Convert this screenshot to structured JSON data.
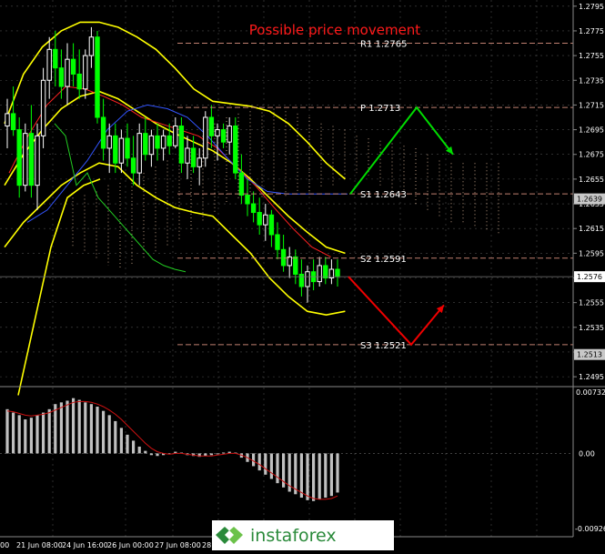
{
  "title": "Possible price movement",
  "colors": {
    "background": "#000000",
    "grid": "#4a4a4a",
    "bollinger": "#ffff00",
    "candle_up": "#ffffff",
    "candle_down": "#00ff00",
    "ma_red": "#ff2222",
    "ma_blue": "#3355ff",
    "chikou": "#22cc22",
    "cloud": "#e8c0a0",
    "level_line": "#c08070",
    "arrow_up": "#00dd00",
    "arrow_down": "#ee0000",
    "histogram": "#c0c0c0",
    "signal": "#cc1111",
    "title": "#ff1a1a",
    "level_text": "#ffffff",
    "axis_text": "#ffffff"
  },
  "levels": [
    {
      "name": "R1",
      "label": "R1 1.2765",
      "value": 1.2765
    },
    {
      "name": "P",
      "label": "P 1.2713",
      "value": 1.2713
    },
    {
      "name": "S1",
      "label": "S1 1.2643",
      "value": 1.2643
    },
    {
      "name": "S2",
      "label": "S2 1.2591",
      "value": 1.2591
    },
    {
      "name": "S3",
      "label": "S3 1.2521",
      "value": 1.2521
    }
  ],
  "price_axis": {
    "ticks": [
      "1.2795",
      "1.2775",
      "1.2755",
      "1.2735",
      "1.2715",
      "1.2695",
      "1.2675",
      "1.2655",
      "1.2635",
      "1.2615",
      "1.2595",
      "1.2575",
      "1.2555",
      "1.2535",
      "1.2515",
      "1.2495"
    ],
    "current_price": "1.2576",
    "marker_upper": "1.2639",
    "marker_lower": "1.2513"
  },
  "macd_axis": {
    "top": "0.00732",
    "zero": "0.00",
    "bottom": "-0.00926"
  },
  "time_labels": [
    "00",
    "21 Jun 08:00",
    "24 Jun 16:00",
    "26 Jun 00:00",
    "27 Jun 08:00",
    "28 Jun"
  ],
  "logo": {
    "brand": "instaforex"
  },
  "chart_data": {
    "type": "candlestick",
    "title": "Possible price movement",
    "ylim": [
      1.2487,
      1.28
    ],
    "candles": [
      {
        "o": 1.2698,
        "h": 1.272,
        "l": 1.268,
        "c": 1.2708
      },
      {
        "o": 1.2708,
        "h": 1.273,
        "l": 1.269,
        "c": 1.2695
      },
      {
        "o": 1.2695,
        "h": 1.2705,
        "l": 1.264,
        "c": 1.265
      },
      {
        "o": 1.265,
        "h": 1.27,
        "l": 1.2645,
        "c": 1.2692
      },
      {
        "o": 1.2692,
        "h": 1.2715,
        "l": 1.264,
        "c": 1.265
      },
      {
        "o": 1.265,
        "h": 1.27,
        "l": 1.263,
        "c": 1.269
      },
      {
        "o": 1.269,
        "h": 1.2745,
        "l": 1.268,
        "c": 1.2735
      },
      {
        "o": 1.2735,
        "h": 1.277,
        "l": 1.272,
        "c": 1.276
      },
      {
        "o": 1.276,
        "h": 1.2775,
        "l": 1.273,
        "c": 1.2745
      },
      {
        "o": 1.2745,
        "h": 1.276,
        "l": 1.272,
        "c": 1.273
      },
      {
        "o": 1.273,
        "h": 1.2765,
        "l": 1.2715,
        "c": 1.2752
      },
      {
        "o": 1.2752,
        "h": 1.2765,
        "l": 1.273,
        "c": 1.274
      },
      {
        "o": 1.274,
        "h": 1.276,
        "l": 1.272,
        "c": 1.2728
      },
      {
        "o": 1.2728,
        "h": 1.276,
        "l": 1.272,
        "c": 1.2755
      },
      {
        "o": 1.2755,
        "h": 1.2778,
        "l": 1.2745,
        "c": 1.277
      },
      {
        "o": 1.277,
        "h": 1.2775,
        "l": 1.27,
        "c": 1.2705
      },
      {
        "o": 1.2705,
        "h": 1.272,
        "l": 1.267,
        "c": 1.268
      },
      {
        "o": 1.268,
        "h": 1.27,
        "l": 1.266,
        "c": 1.269
      },
      {
        "o": 1.269,
        "h": 1.27,
        "l": 1.266,
        "c": 1.2668
      },
      {
        "o": 1.2668,
        "h": 1.2695,
        "l": 1.266,
        "c": 1.2688
      },
      {
        "o": 1.2688,
        "h": 1.27,
        "l": 1.2665,
        "c": 1.2672
      },
      {
        "o": 1.2672,
        "h": 1.269,
        "l": 1.265,
        "c": 1.266
      },
      {
        "o": 1.266,
        "h": 1.27,
        "l": 1.265,
        "c": 1.2692
      },
      {
        "o": 1.2692,
        "h": 1.2705,
        "l": 1.267,
        "c": 1.2675
      },
      {
        "o": 1.2675,
        "h": 1.2695,
        "l": 1.2665,
        "c": 1.269
      },
      {
        "o": 1.269,
        "h": 1.27,
        "l": 1.267,
        "c": 1.268
      },
      {
        "o": 1.268,
        "h": 1.2695,
        "l": 1.267,
        "c": 1.269
      },
      {
        "o": 1.269,
        "h": 1.27,
        "l": 1.2675,
        "c": 1.2682
      },
      {
        "o": 1.2682,
        "h": 1.2705,
        "l": 1.268,
        "c": 1.2698
      },
      {
        "o": 1.2698,
        "h": 1.2705,
        "l": 1.266,
        "c": 1.2668
      },
      {
        "o": 1.2668,
        "h": 1.269,
        "l": 1.2655,
        "c": 1.268
      },
      {
        "o": 1.268,
        "h": 1.269,
        "l": 1.266,
        "c": 1.2665
      },
      {
        "o": 1.2665,
        "h": 1.268,
        "l": 1.265,
        "c": 1.2672
      },
      {
        "o": 1.2672,
        "h": 1.271,
        "l": 1.2665,
        "c": 1.2705
      },
      {
        "o": 1.2705,
        "h": 1.2715,
        "l": 1.268,
        "c": 1.269
      },
      {
        "o": 1.269,
        "h": 1.27,
        "l": 1.267,
        "c": 1.2695
      },
      {
        "o": 1.2695,
        "h": 1.27,
        "l": 1.268,
        "c": 1.2685
      },
      {
        "o": 1.2685,
        "h": 1.2705,
        "l": 1.2675,
        "c": 1.2698
      },
      {
        "o": 1.2698,
        "h": 1.2705,
        "l": 1.2655,
        "c": 1.266
      },
      {
        "o": 1.266,
        "h": 1.2675,
        "l": 1.2635,
        "c": 1.2642
      },
      {
        "o": 1.2642,
        "h": 1.2655,
        "l": 1.2625,
        "c": 1.2635
      },
      {
        "o": 1.2635,
        "h": 1.2645,
        "l": 1.262,
        "c": 1.2628
      },
      {
        "o": 1.2628,
        "h": 1.264,
        "l": 1.261,
        "c": 1.2618
      },
      {
        "o": 1.2618,
        "h": 1.2635,
        "l": 1.2605,
        "c": 1.2626
      },
      {
        "o": 1.2626,
        "h": 1.263,
        "l": 1.26,
        "c": 1.261
      },
      {
        "o": 1.261,
        "h": 1.262,
        "l": 1.259,
        "c": 1.2598
      },
      {
        "o": 1.2598,
        "h": 1.261,
        "l": 1.258,
        "c": 1.2585
      },
      {
        "o": 1.2585,
        "h": 1.26,
        "l": 1.2575,
        "c": 1.2592
      },
      {
        "o": 1.2592,
        "h": 1.2598,
        "l": 1.257,
        "c": 1.2578
      },
      {
        "o": 1.2578,
        "h": 1.259,
        "l": 1.256,
        "c": 1.2568
      },
      {
        "o": 1.2568,
        "h": 1.2585,
        "l": 1.2555,
        "c": 1.258
      },
      {
        "o": 1.258,
        "h": 1.259,
        "l": 1.2565,
        "c": 1.2572
      },
      {
        "o": 1.2572,
        "h": 1.2592,
        "l": 1.2568,
        "c": 1.2585
      },
      {
        "o": 1.2585,
        "h": 1.2592,
        "l": 1.257,
        "c": 1.2575
      },
      {
        "o": 1.2575,
        "h": 1.259,
        "l": 1.257,
        "c": 1.2582
      },
      {
        "o": 1.2582,
        "h": 1.259,
        "l": 1.2568,
        "c": 1.2576
      }
    ],
    "macd_histogram": [
      0.0052,
      0.0048,
      0.0045,
      0.004,
      0.0042,
      0.0045,
      0.0048,
      0.0052,
      0.0058,
      0.006,
      0.0062,
      0.0065,
      0.0063,
      0.006,
      0.0058,
      0.0055,
      0.005,
      0.0045,
      0.0038,
      0.003,
      0.0022,
      0.0015,
      0.0008,
      0.0003,
      -0.0002,
      -0.0003,
      -0.0002,
      0.0,
      0.0002,
      0.0001,
      -0.0002,
      -0.0003,
      -0.0004,
      -0.0003,
      -0.0002,
      -0.0001,
      0.0001,
      0.0002,
      0.0001,
      -0.0005,
      -0.001,
      -0.0015,
      -0.002,
      -0.0025,
      -0.003,
      -0.0035,
      -0.004,
      -0.0045,
      -0.0048,
      -0.0052,
      -0.0055,
      -0.0056,
      -0.0054,
      -0.0052,
      -0.005,
      -0.0046
    ],
    "macd_signal": [
      0.005,
      0.0049,
      0.0047,
      0.0045,
      0.0044,
      0.0045,
      0.0046,
      0.0048,
      0.0051,
      0.0054,
      0.0057,
      0.006,
      0.0061,
      0.0061,
      0.006,
      0.0058,
      0.0055,
      0.0051,
      0.0046,
      0.004,
      0.0033,
      0.0026,
      0.0019,
      0.0012,
      0.0006,
      0.0002,
      -0.0,
      -0.0001,
      -0.0,
      0.0,
      -0.0001,
      -0.0002,
      -0.0003,
      -0.0003,
      -0.0003,
      -0.0002,
      -0.0001,
      0.0,
      0.0,
      -0.0002,
      -0.0005,
      -0.0009,
      -0.0013,
      -0.0018,
      -0.0023,
      -0.0028,
      -0.0033,
      -0.0038,
      -0.0042,
      -0.0046,
      -0.005,
      -0.0053,
      -0.0054,
      -0.0054,
      -0.0053,
      -0.005
    ],
    "forecast": {
      "bullish": [
        1.2643,
        1.2713,
        1.2675
      ],
      "bearish": [
        1.2576,
        1.2521,
        1.2553
      ]
    }
  }
}
